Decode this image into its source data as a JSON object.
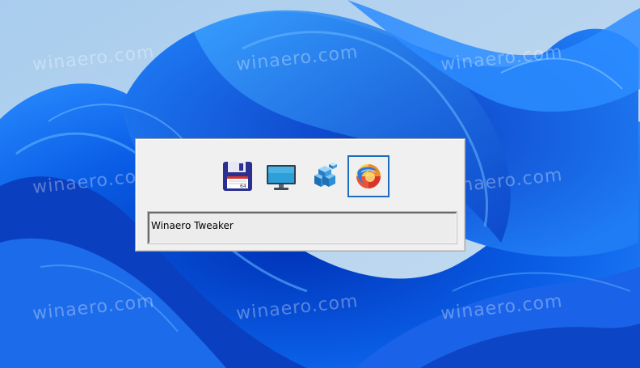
{
  "watermark": "winaero.com",
  "switcher": {
    "items": [
      {
        "icon": "floppy-disk-icon",
        "label": "Save"
      },
      {
        "icon": "monitor-icon",
        "label": "Desktop"
      },
      {
        "icon": "registry-editor-icon",
        "label": "Registry Editor"
      },
      {
        "icon": "winaero-tweaker-icon",
        "label": "Winaero Tweaker"
      }
    ],
    "selected_index": 3,
    "selected_title": "Winaero Tweaker"
  },
  "colors": {
    "selection_border": "#1c6dbb",
    "dialog_background": "#f0f0f0",
    "wallpaper_blue": "#0a55d8"
  }
}
